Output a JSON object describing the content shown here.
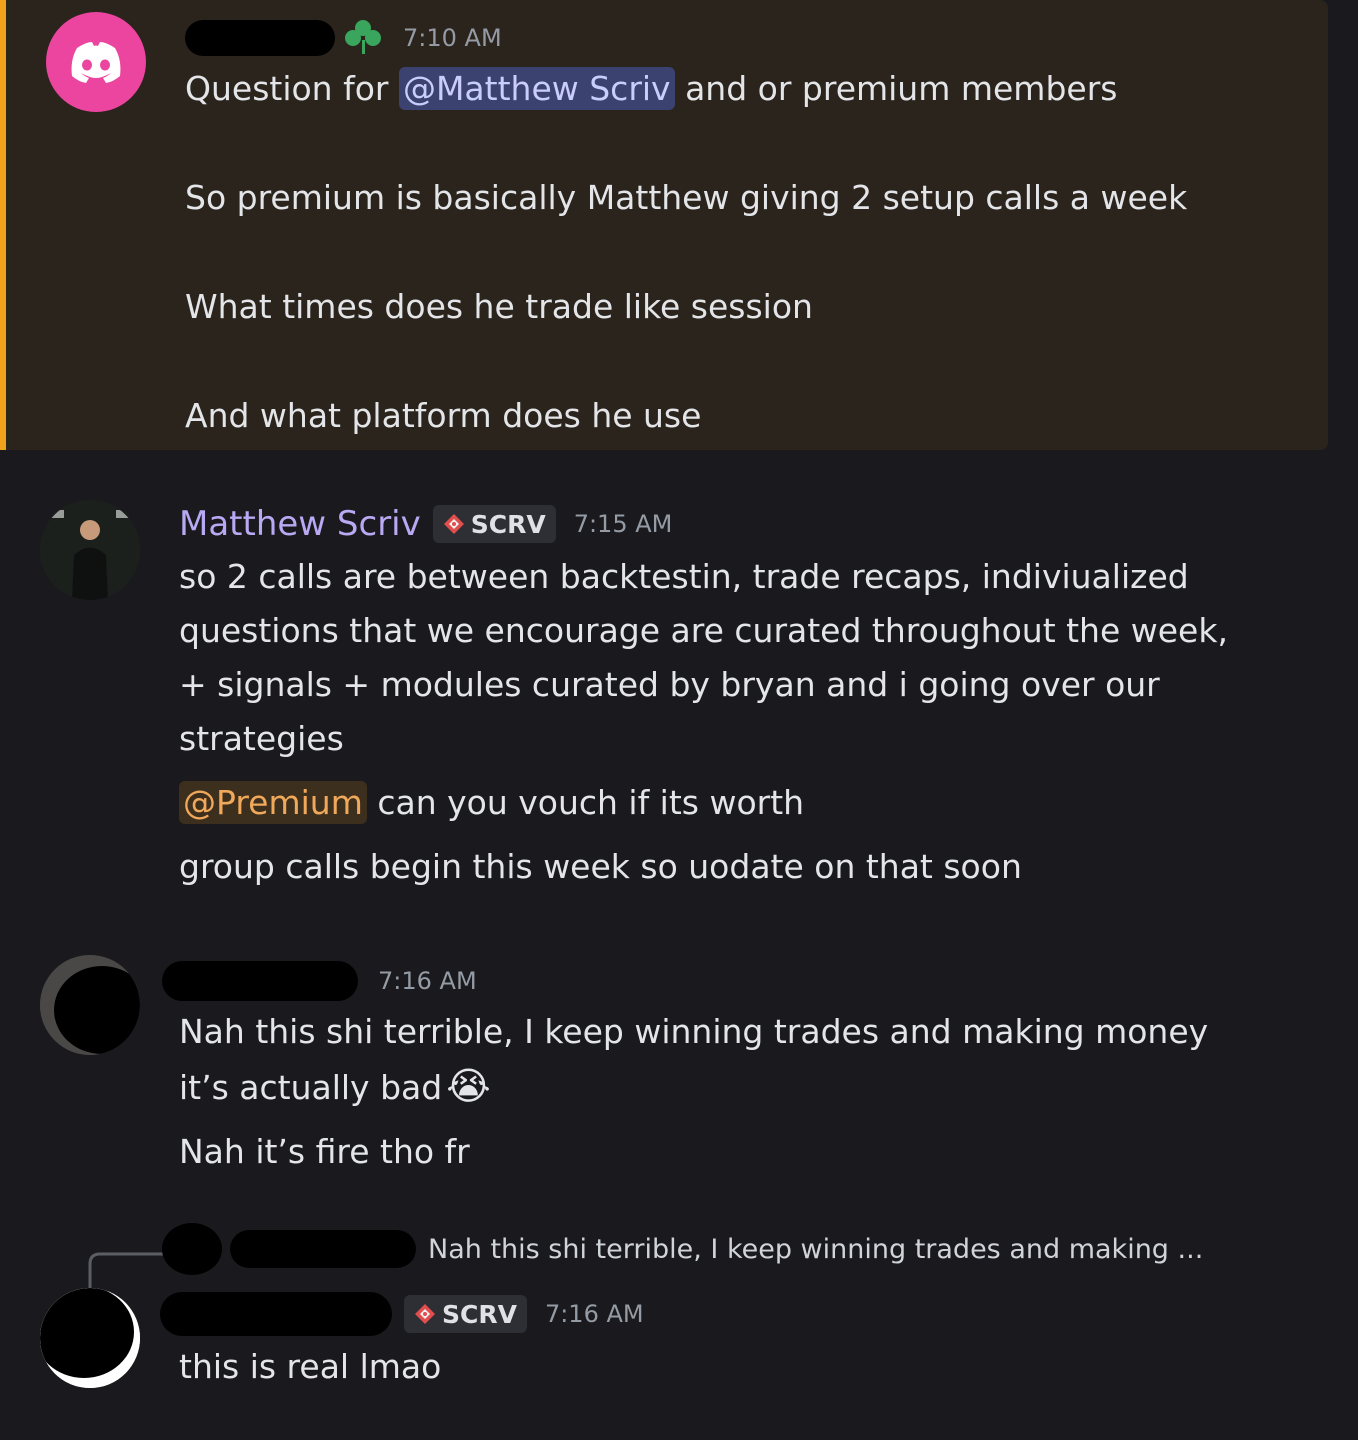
{
  "messages": [
    {
      "timestamp": "7:10 AM",
      "mention": "@Matthew Scriv",
      "line1_before": "Question for ",
      "line1_after": " and or premium members",
      "line2": "So premium is basically Matthew giving 2 setup calls  a week",
      "line3": "What times does he trade like session",
      "line4": "And what platform does he use"
    },
    {
      "author": "Matthew Scriv",
      "tag": "SCRV",
      "timestamp": "7:15 AM",
      "lines": [
        "so 2 calls are between backtestin, trade recaps, indiviualized",
        "questions that we encourage are curated throughout the week,",
        "+ signals + modules curated by bryan and i going over our",
        "strategies"
      ],
      "role_mention": "@Premium",
      "vouch_text": " can you vouch if its worth",
      "group_calls": "group calls begin this week so uodate on that soon"
    },
    {
      "timestamp": "7:16 AM",
      "line1": "Nah this shi terrible, I keep winning trades and making money",
      "line2": "it’s actually bad",
      "emoji": "😭",
      "line3": "Nah it’s fire tho fr"
    },
    {
      "reply_preview": "Nah this shi terrible, I keep winning trades and making ...",
      "tag": "SCRV",
      "timestamp": "7:16 AM",
      "text": "this is real lmao"
    }
  ],
  "colors": {
    "accent_highlight": "#f0a21a",
    "mention_bg": "#3c4270",
    "discord_pink": "#eb459f"
  }
}
